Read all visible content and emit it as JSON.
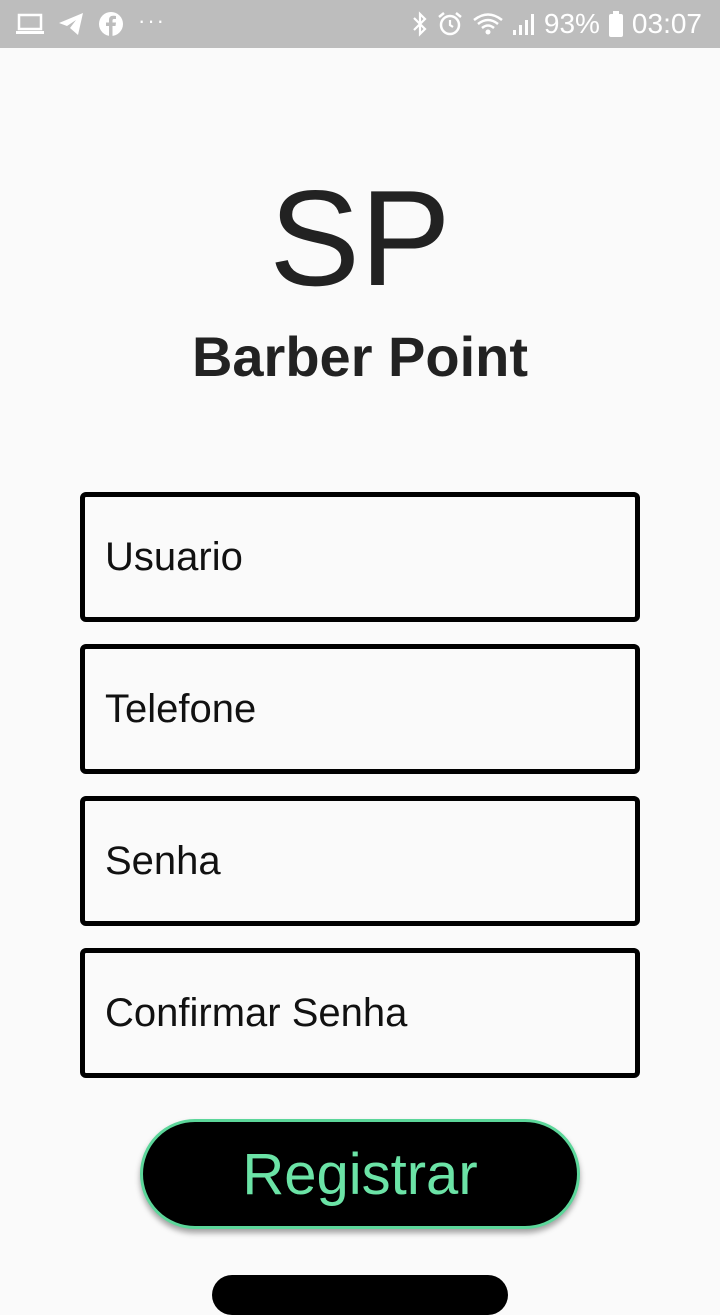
{
  "status_bar": {
    "left_icons": [
      "laptop-icon",
      "telegram-icon",
      "facebook-icon"
    ],
    "more": "···",
    "right_icons": [
      "bluetooth-icon",
      "alarm-icon",
      "wifi-icon",
      "signal-icon"
    ],
    "battery_percent": "93%",
    "time": "03:07",
    "background": "#bdbdbd"
  },
  "header": {
    "logo": "SP",
    "app_name": "Barber Point"
  },
  "form": {
    "username_placeholder": "Usuario",
    "phone_placeholder": "Telefone",
    "password_placeholder": "Senha",
    "confirm_password_placeholder": "Confirmar Senha"
  },
  "actions": {
    "register_label": "Registrar",
    "accent_color": "#6be3a6"
  }
}
